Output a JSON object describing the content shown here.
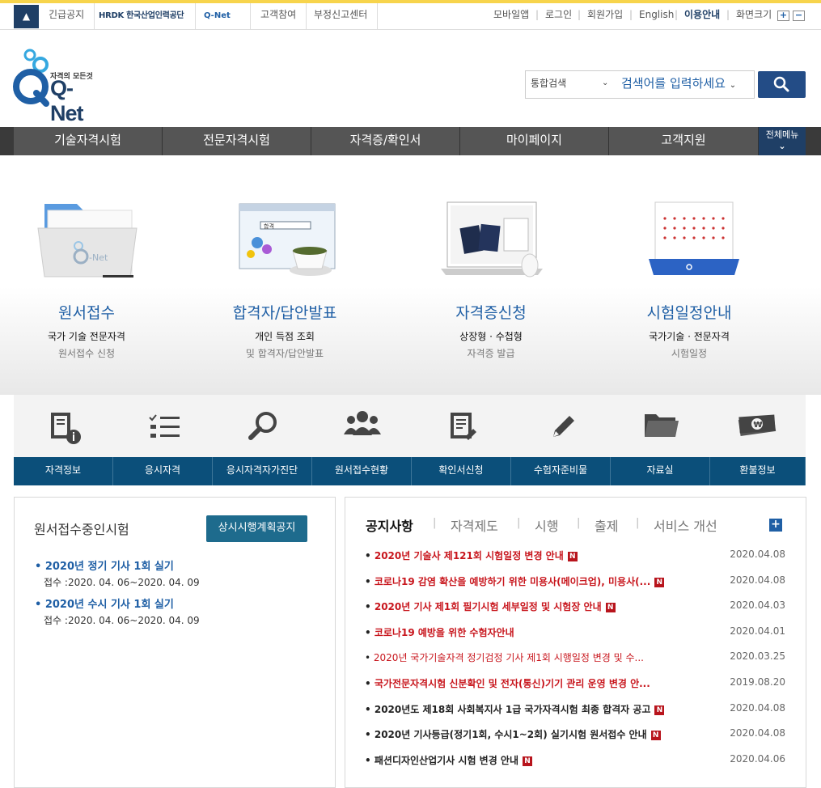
{
  "topbar": {
    "left_links": [
      "긴급공지",
      "HRDK 한국산업인력공단",
      "Q-Net",
      "고객참여",
      "부정신고센터"
    ],
    "right_links": [
      "모바일앱",
      "로그인",
      "회원가입",
      "English",
      "이용안내",
      "화면크기"
    ],
    "zoom_in": "+",
    "zoom_out": "−"
  },
  "logo": {
    "tagline": "자격의 모든것",
    "name": "Q-Net"
  },
  "search": {
    "type": "통합검색",
    "placeholder": "검색어를 입력하세요"
  },
  "gnb": {
    "items": [
      "기술자격시험",
      "전문자격시험",
      "자격증/확인서",
      "마이페이지",
      "고객지원"
    ],
    "all_menu": "전체메뉴"
  },
  "hero": [
    {
      "title": "원서접수",
      "line1": "국가 기술 전문자격",
      "line2": "원서접수 신청"
    },
    {
      "title": "합격자/답안발표",
      "line1": "개인 득점 조회",
      "line2": "및 합격자/답안발표"
    },
    {
      "title": "자격증신청",
      "line1": "상장형 · 수첩형",
      "line2": "자격증 발급"
    },
    {
      "title": "시험일정안내",
      "line1": "국가기술 · 전문자격",
      "line2": "시험일정"
    }
  ],
  "quick": [
    {
      "label": "자격정보",
      "icon": "document-info-icon"
    },
    {
      "label": "응시자격",
      "icon": "checklist-icon"
    },
    {
      "label": "응시자격자가진단",
      "icon": "magnifier-icon"
    },
    {
      "label": "원서접수현황",
      "icon": "people-icon"
    },
    {
      "label": "확인서신청",
      "icon": "document-edit-icon"
    },
    {
      "label": "수험자준비물",
      "icon": "pencil-icon"
    },
    {
      "label": "자료실",
      "icon": "folder-icon"
    },
    {
      "label": "환불정보",
      "icon": "money-icon"
    }
  ],
  "exams": {
    "title": "원서접수중인시험",
    "button": "상시시행계획공지",
    "items": [
      {
        "name": "2020년 정기 기사 1회 실기",
        "date": "접수 :2020. 04. 06~2020. 04. 09"
      },
      {
        "name": "2020년 수시 기사 1회 실기",
        "date": "접수 :2020. 04. 06~2020. 04. 09"
      }
    ]
  },
  "notices": {
    "tabs": [
      "공지사항",
      "자격제도",
      "시행",
      "출제",
      "서비스 개선"
    ],
    "more": "+",
    "badge": "N",
    "items": [
      {
        "title": "2020년 기술사 제121회 시험일정 변경 안내",
        "date": "2020.04.08",
        "red": true,
        "bold": true,
        "new": true
      },
      {
        "title": "코로나19 감염 확산을 예방하기 위한 미용사(메이크업), 미용사(...",
        "date": "2020.04.08",
        "red": true,
        "bold": true,
        "new": true
      },
      {
        "title": "2020년 기사 제1회 필기시험 세부일정 및 시험장 안내",
        "date": "2020.04.03",
        "red": true,
        "bold": true,
        "new": true
      },
      {
        "title": "코로나19 예방을 위한 수험자안내",
        "date": "2020.04.01",
        "red": true,
        "bold": true,
        "new": false
      },
      {
        "title": "2020년 국가기술자격 정기검정 기사 제1회 시행일정 변경 및 수...",
        "date": "2020.03.25",
        "red": true,
        "bold": false,
        "new": false
      },
      {
        "title": "국가전문자격시험 신분확인 및 전자(통신)기기 관리 운영 변경 안...",
        "date": "2019.08.20",
        "red": true,
        "bold": true,
        "new": false
      },
      {
        "title": "2020년도 제18회 사회복지사 1급 국가자격시험 최종 합격자 공고",
        "date": "2020.04.08",
        "red": false,
        "bold": true,
        "new": true
      },
      {
        "title": "2020년 기사등급(정기1회, 수시1~2회) 실기시험 원서접수 안내",
        "date": "2020.04.08",
        "red": false,
        "bold": true,
        "new": true
      },
      {
        "title": "패션디자인산업기사 시험 변경 안내",
        "date": "2020.04.06",
        "red": false,
        "bold": true,
        "new": true
      }
    ]
  },
  "colors": {
    "brand": "#1f3f66",
    "accent": "#1f5fa5",
    "notice_red": "#c8161d",
    "quick_bar": "#0b4f7a"
  }
}
